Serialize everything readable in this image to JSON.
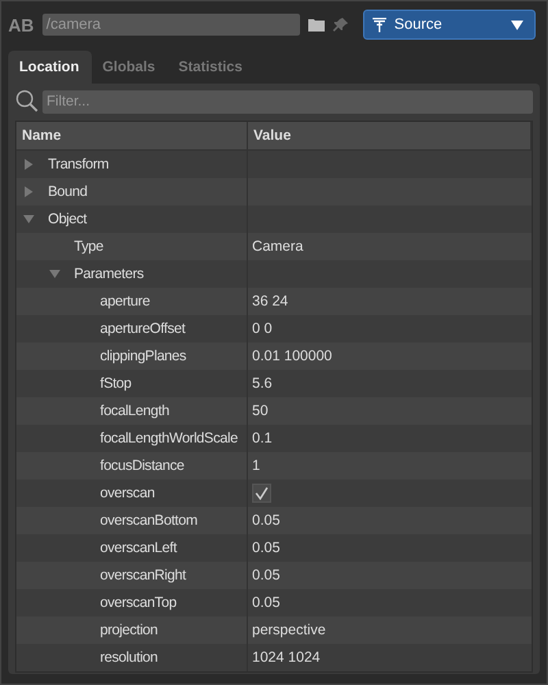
{
  "toolbar": {
    "logo": "AB",
    "path": "/camera",
    "mode": "Source"
  },
  "tabs": [
    {
      "label": "Location",
      "selected": true
    },
    {
      "label": "Globals",
      "selected": false
    },
    {
      "label": "Statistics",
      "selected": false
    }
  ],
  "filter": {
    "placeholder": "Filter..."
  },
  "table": {
    "columns": [
      "Name",
      "Value"
    ],
    "rows": [
      {
        "name": "Transform",
        "expanded": false
      },
      {
        "name": "Bound",
        "expanded": false
      },
      {
        "name": "Object",
        "expanded": true,
        "children": [
          {
            "name": "Type",
            "value": "Camera"
          },
          {
            "name": "Parameters",
            "expanded": true,
            "children": [
              {
                "name": "aperture",
                "value": "36 24"
              },
              {
                "name": "apertureOffset",
                "value": "0 0"
              },
              {
                "name": "clippingPlanes",
                "value": "0.01 100000"
              },
              {
                "name": "fStop",
                "value": "5.6"
              },
              {
                "name": "focalLength",
                "value": "50"
              },
              {
                "name": "focalLengthWorldScale",
                "value": "0.1"
              },
              {
                "name": "focusDistance",
                "value": "1"
              },
              {
                "name": "overscan",
                "kind": "checkbox",
                "checked": true
              },
              {
                "name": "overscanBottom",
                "value": "0.05"
              },
              {
                "name": "overscanLeft",
                "value": "0.05"
              },
              {
                "name": "overscanRight",
                "value": "0.05"
              },
              {
                "name": "overscanTop",
                "value": "0.05"
              },
              {
                "name": "projection",
                "value": "perspective"
              },
              {
                "name": "resolution",
                "value": "1024 1024"
              }
            ]
          }
        ]
      }
    ]
  }
}
